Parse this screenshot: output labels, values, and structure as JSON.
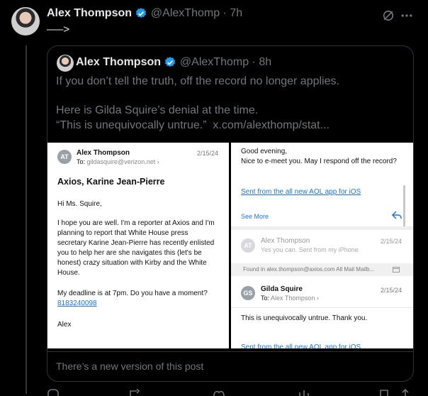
{
  "post": {
    "author_name": "Alex Thompson",
    "handle": "@AlexThomp",
    "time": "· 7h",
    "text": "—–>"
  },
  "quote": {
    "author_name": "Alex Thompson",
    "handle": "@AlexThomp",
    "time": "· 8h",
    "line1": "If you don’t tell the truth, off the record no longer applies.",
    "line2": "Here is Gilda Squire’s denial at the time.",
    "line3": "“This is unequivocally untrue.”  x.com/alexthomp/stat..."
  },
  "email_left": {
    "avatar_initials": "AT",
    "from": "Alex Thompson",
    "date": "2/15/24",
    "to_prefix": "To:",
    "to": "gildasquire@verizon.net",
    "subject": "Axios, Karine Jean-Pierre",
    "greeting": "Hi Ms. Squire,",
    "p1l1": "I hope you are well. I'm a reporter at Axios and I'm",
    "p1l2": "planning to report that White House press",
    "p1l3": "secretary Karine Jean-Pierre has recently enlisted",
    "p1l4": "you to help her are she navigates this (let's be",
    "p1l5": "honest) crazy situation with Kirby and the White",
    "p1l6": "House.",
    "p2l1": "My deadline is at 7pm. Do you have a moment?",
    "phone": "8183240098",
    "signoff": "Alex"
  },
  "email_right": {
    "line1": "Good evening,",
    "line2": "Nice to e-meet you. May I respond off the record?",
    "aol_link": "Sent from the all new AOL app for iOS",
    "see_more": "See More",
    "collapsed_avatar": "AT",
    "collapsed_from": "Alex Thompson",
    "collapsed_preview": "Yes you can. Sent from my iPhone",
    "collapsed_date": "2/15/24",
    "found_in": "Found in alex.thompson@axios.com All Mail Mailb...",
    "gs_avatar": "GS",
    "gs_from": "Gilda Squire",
    "gs_to_prefix": "To:",
    "gs_to": "Alex Thompson",
    "gs_date": "2/15/24",
    "gs_body": "This is unequivocally untrue. Thank you.",
    "gs_link_cut": "Sent from the all new AOL app for iOS"
  },
  "notice": "There’s a new version of this post",
  "colors": {
    "verified": "#1d9bf0",
    "link": "#1a73e8",
    "muted": "#71767b"
  }
}
